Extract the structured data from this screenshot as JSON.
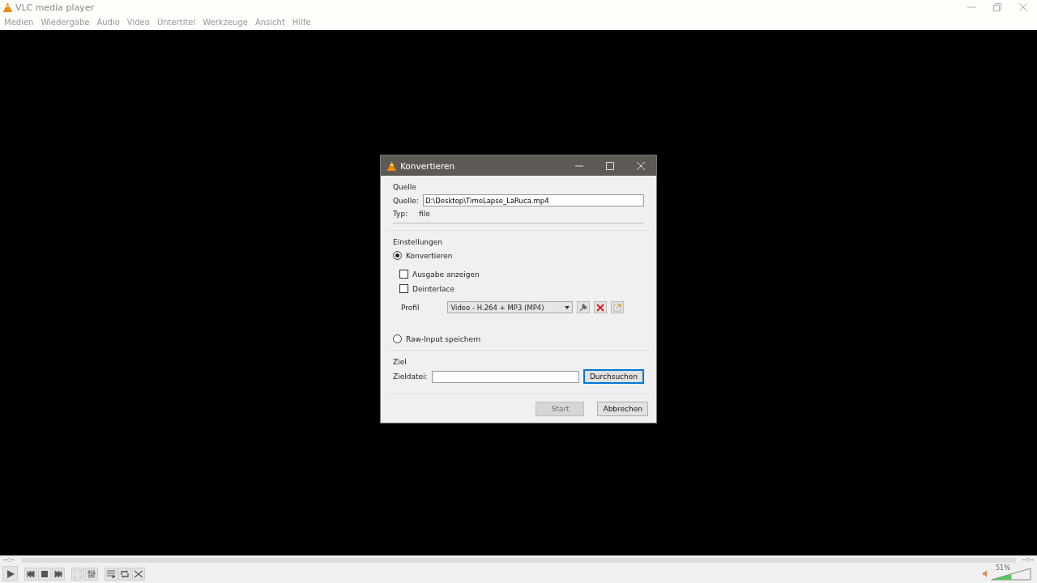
{
  "window": {
    "title": "VLC media player"
  },
  "menu": [
    "Medien",
    "Wiedergabe",
    "Audio",
    "Video",
    "Untertitel",
    "Werkzeuge",
    "Ansicht",
    "Hilfe"
  ],
  "dialog": {
    "title": "Konvertieren",
    "source": {
      "heading": "Quelle",
      "label": "Quelle:",
      "value": "D:\\Desktop\\TimeLapse_LaRuca.mp4",
      "type_label": "Typ:",
      "type_value": "file"
    },
    "settings": {
      "heading": "Einstellungen",
      "modes": [
        {
          "label": "Konvertieren",
          "selected": true
        },
        {
          "label": "Raw-Input speichern",
          "selected": false
        }
      ],
      "options": [
        {
          "label": "Ausgabe anzeigen",
          "checked": false
        },
        {
          "label": "Deinterlace",
          "checked": false
        }
      ],
      "profile_label": "Profil",
      "profile_value": "Video - H.264 + MP3 (MP4)"
    },
    "target": {
      "heading": "Ziel",
      "label": "Zieldatei:",
      "browse": "Durchsuchen"
    },
    "buttons": [
      {
        "label": "Start",
        "disabled": true
      },
      {
        "label": "Abbrechen",
        "disabled": false
      }
    ]
  },
  "player": {
    "elapsed": "--:--",
    "remaining": "--:--",
    "volume": {
      "reading": "51%",
      "level": 0.51
    }
  }
}
